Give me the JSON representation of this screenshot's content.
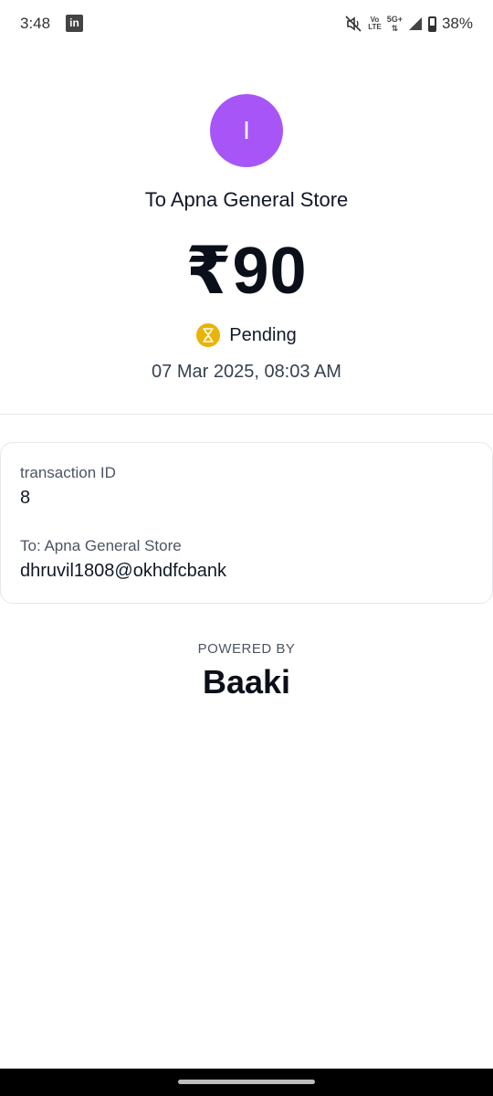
{
  "status_bar": {
    "time": "3:48",
    "app_icon": "linkedin-icon",
    "volte_top": "Vo",
    "volte_bottom": "LTE",
    "network": "5G+",
    "battery_percent": "38%"
  },
  "transaction": {
    "avatar_initial": "I",
    "title": "To Apna General Store",
    "amount": "₹90",
    "status": "Pending",
    "status_icon": "hourglass-icon",
    "status_color": "#eab308",
    "datetime": "07 Mar 2025, 08:03 AM"
  },
  "details": {
    "transaction_id_label": "transaction ID",
    "transaction_id_value": "8",
    "to_label": "To: Apna General Store",
    "to_value": "dhruvil1808@okhdfcbank"
  },
  "footer": {
    "powered_by": "POWERED BY",
    "brand": "Baaki"
  },
  "colors": {
    "avatar": "#a855f7",
    "pending": "#eab308"
  }
}
